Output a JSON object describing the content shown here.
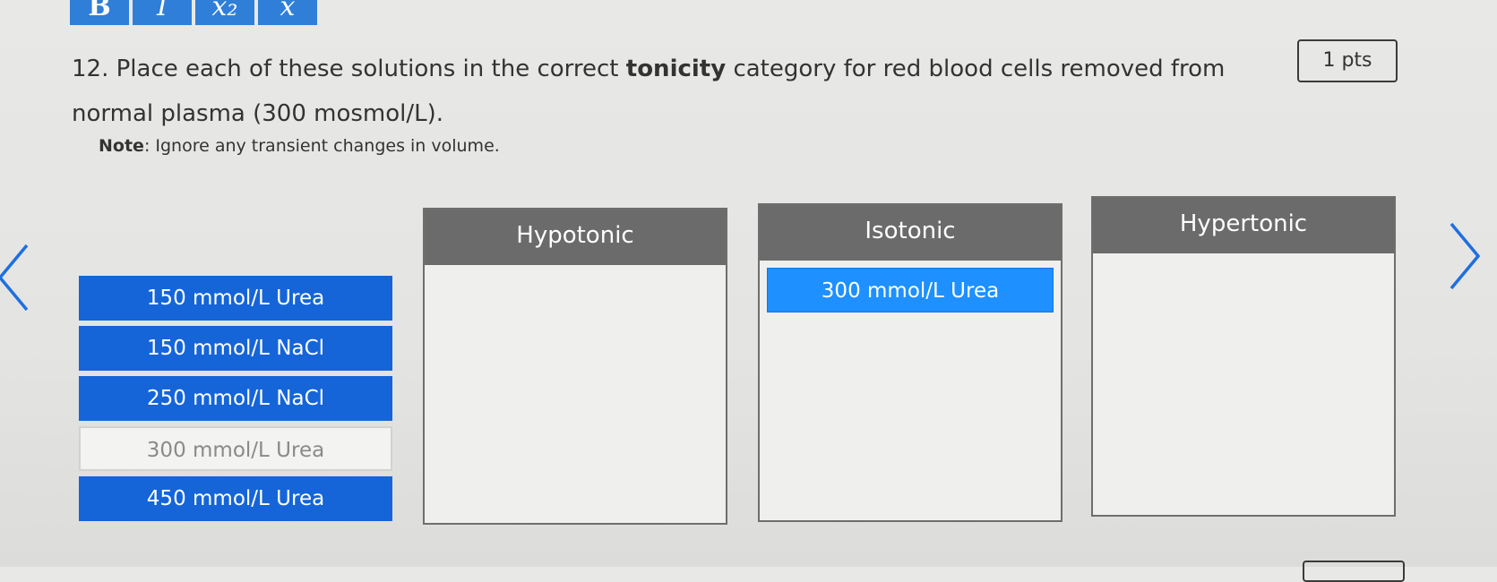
{
  "toolbar": {
    "buttons": [
      {
        "label": "B",
        "name": "bold"
      },
      {
        "label": "I",
        "name": "italic"
      },
      {
        "label": "x₂",
        "name": "subscript"
      },
      {
        "label": "x",
        "name": "superscript"
      }
    ]
  },
  "question": {
    "number": "12.",
    "text_before": "Place each of these solutions in the correct",
    "bold_word": "tonicity",
    "text_after": "category for red blood cells removed from normal plasma (300 mosmol/L).",
    "note_label": "Note",
    "note_text": ": Ignore any transient changes in volume.",
    "points": "1 pts"
  },
  "source_items": [
    {
      "label": "150 mmol/L Urea",
      "placed": false
    },
    {
      "label": "150 mmol/L  NaCl",
      "placed": false
    },
    {
      "label": "250 mmol/L NaCl",
      "placed": false
    },
    {
      "label": "300 mmol/L Urea",
      "placed": true
    },
    {
      "label": "450 mmol/L Urea",
      "placed": false
    }
  ],
  "categories": [
    {
      "title": "Hypotonic",
      "items": []
    },
    {
      "title": "Isotonic",
      "items": [
        "300 mmol/L Urea"
      ]
    },
    {
      "title": "Hypertonic",
      "items": []
    }
  ],
  "colors": {
    "chip": "#1565d8",
    "placed_chip": "#1e90ff",
    "header": "#6b6b6b",
    "arrow": "#1e6fe0"
  }
}
